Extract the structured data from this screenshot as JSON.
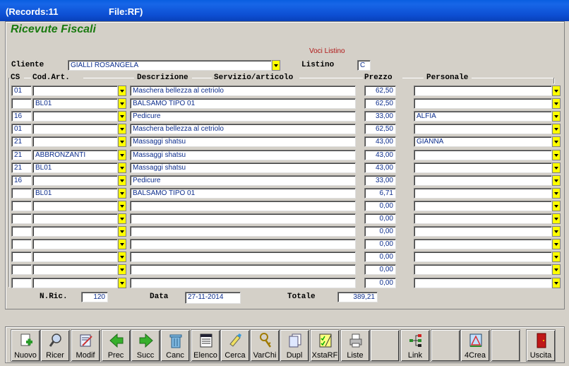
{
  "window": {
    "records_label": "(Records:11",
    "file_label": "File:RF)"
  },
  "app_title": "Ricevute Fiscali",
  "voci_listino": "Voci Listino",
  "cliente": {
    "label": "Cliente",
    "value": "GIALLI ROSANGELA"
  },
  "listino": {
    "label": "Listino",
    "value": "C"
  },
  "columns": {
    "cs": "CS",
    "cod_art": "Cod.Art.",
    "descrizione": "Descrizione",
    "servizio": "Servizio/articolo",
    "prezzo": "Prezzo",
    "personale": "Personale"
  },
  "rows": [
    {
      "cs": "01",
      "cod": "",
      "desc": "Maschera bellezza al cetriolo",
      "prezzo": "62,50",
      "pers": ""
    },
    {
      "cs": "",
      "cod": "BL01",
      "desc": "BALSAMO TIPO 01",
      "prezzo": "62,50",
      "pers": ""
    },
    {
      "cs": "16",
      "cod": "",
      "desc": "Pedicure",
      "prezzo": "33,00",
      "pers": "ALFIA"
    },
    {
      "cs": "01",
      "cod": "",
      "desc": "Maschera bellezza al cetriolo",
      "prezzo": "62,50",
      "pers": ""
    },
    {
      "cs": "21",
      "cod": "",
      "desc": "Massaggi shatsu",
      "prezzo": "43,00",
      "pers": "GIANNA"
    },
    {
      "cs": "21",
      "cod": "ABBRONZANTI",
      "desc": "Massaggi shatsu",
      "prezzo": "43,00",
      "pers": ""
    },
    {
      "cs": "21",
      "cod": "BL01",
      "desc": "Massaggi shatsu",
      "prezzo": "43,00",
      "pers": ""
    },
    {
      "cs": "16",
      "cod": "",
      "desc": "Pedicure",
      "prezzo": "33,00",
      "pers": ""
    },
    {
      "cs": "",
      "cod": "BL01",
      "desc": "BALSAMO TIPO 01",
      "prezzo": "6,71",
      "pers": ""
    },
    {
      "cs": "",
      "cod": "",
      "desc": "",
      "prezzo": "0,00",
      "pers": ""
    },
    {
      "cs": "",
      "cod": "",
      "desc": "",
      "prezzo": "0,00",
      "pers": ""
    },
    {
      "cs": "",
      "cod": "",
      "desc": "",
      "prezzo": "0,00",
      "pers": ""
    },
    {
      "cs": "",
      "cod": "",
      "desc": "",
      "prezzo": "0,00",
      "pers": ""
    },
    {
      "cs": "",
      "cod": "",
      "desc": "",
      "prezzo": "0,00",
      "pers": ""
    },
    {
      "cs": "",
      "cod": "",
      "desc": "",
      "prezzo": "0,00",
      "pers": ""
    },
    {
      "cs": "",
      "cod": "",
      "desc": "",
      "prezzo": "0,00",
      "pers": ""
    }
  ],
  "footer": {
    "nric_label": "N.Ric.",
    "nric_value": "120",
    "data_label": "Data",
    "data_value": "27-11-2014",
    "totale_label": "Totale",
    "totale_value": "389,21"
  },
  "toolbar": [
    {
      "label": "Nuovo",
      "icon": "new-doc-icon"
    },
    {
      "label": "Ricer",
      "icon": "search-icon"
    },
    {
      "label": "Modif",
      "icon": "edit-icon"
    },
    {
      "label": "Prec",
      "icon": "arrow-left-icon"
    },
    {
      "label": "Succ",
      "icon": "arrow-right-icon"
    },
    {
      "label": "Canc",
      "icon": "trash-icon"
    },
    {
      "label": "Elenco",
      "icon": "list-icon"
    },
    {
      "label": "Cerca",
      "icon": "find-icon"
    },
    {
      "label": "VarChi",
      "icon": "keys-icon"
    },
    {
      "label": "Dupl",
      "icon": "copy-icon"
    },
    {
      "label": "XstaRF",
      "icon": "checklist-icon"
    },
    {
      "label": "Liste",
      "icon": "printer-icon"
    },
    {
      "label": "",
      "icon": ""
    },
    {
      "label": "Link",
      "icon": "tree-icon"
    },
    {
      "label": "",
      "icon": ""
    },
    {
      "label": "4Crea",
      "icon": "create-icon"
    },
    {
      "label": "",
      "icon": ""
    },
    {
      "label": "Uscita",
      "icon": "exit-door-icon"
    }
  ],
  "colors": {
    "title_green": "#1a7a10",
    "field_text": "#0c2d8c",
    "dropdown_yellow": "#ffff00",
    "titlebar_blue": "#0d4fd3"
  }
}
